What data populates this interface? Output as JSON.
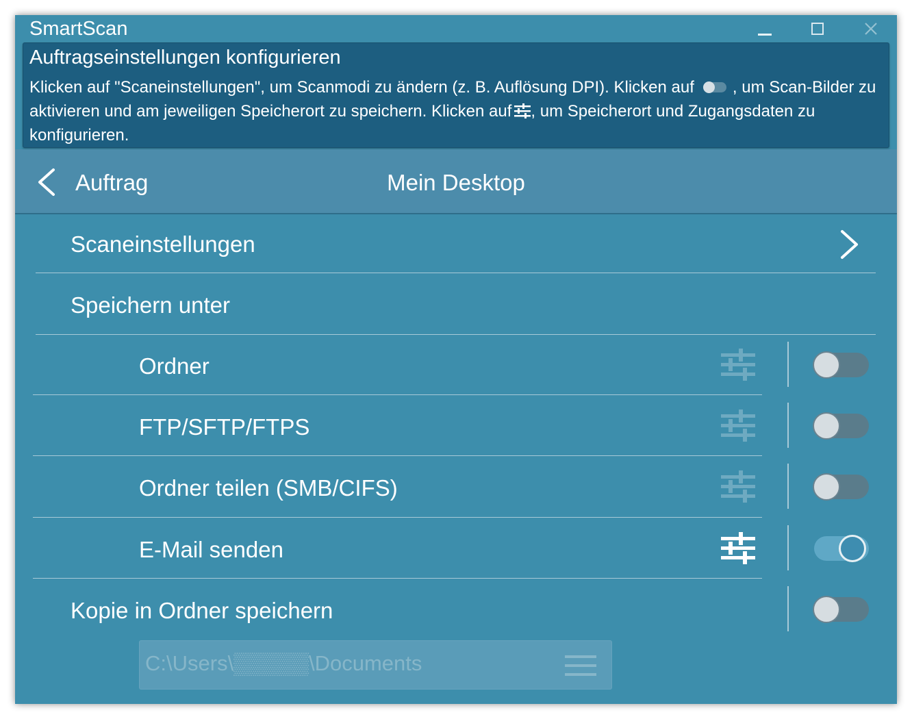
{
  "window": {
    "title": "SmartScan"
  },
  "banner": {
    "title": "Auftragseinstellungen konfigurieren",
    "text_part1": "Klicken auf \"Scaneinstellungen\", um Scanmodi zu ändern (z. B. Auflösung DPI).  Klicken auf",
    "text_part2": ", um Scan-Bilder zu aktivieren und am jeweiligen Speicherort zu speichern. Klicken auf",
    "text_part3": ", um Speicherort und Zugangsdaten zu konfigurieren."
  },
  "nav": {
    "back_label": "Auftrag",
    "title": "Mein Desktop"
  },
  "scan_settings": {
    "label": "Scaneinstellungen"
  },
  "save_as": {
    "label": "Speichern unter",
    "destinations": [
      {
        "label": "Ordner",
        "enabled": false,
        "settings_available": false
      },
      {
        "label": "FTP/SFTP/FTPS",
        "enabled": false,
        "settings_available": false
      },
      {
        "label": "Ordner teilen (SMB/CIFS)",
        "enabled": false,
        "settings_available": false
      },
      {
        "label": "E-Mail senden",
        "enabled": true,
        "settings_available": true
      }
    ]
  },
  "copy_to_folder": {
    "label": "Kopie in Ordner speichern",
    "enabled": false,
    "path": "C:\\Users\\▒▒▒▒▒\\Documents"
  },
  "colors": {
    "window_bg": "#3d8eac",
    "banner_bg": "#1d5e80",
    "navbar_bg": "#4c8cab"
  }
}
